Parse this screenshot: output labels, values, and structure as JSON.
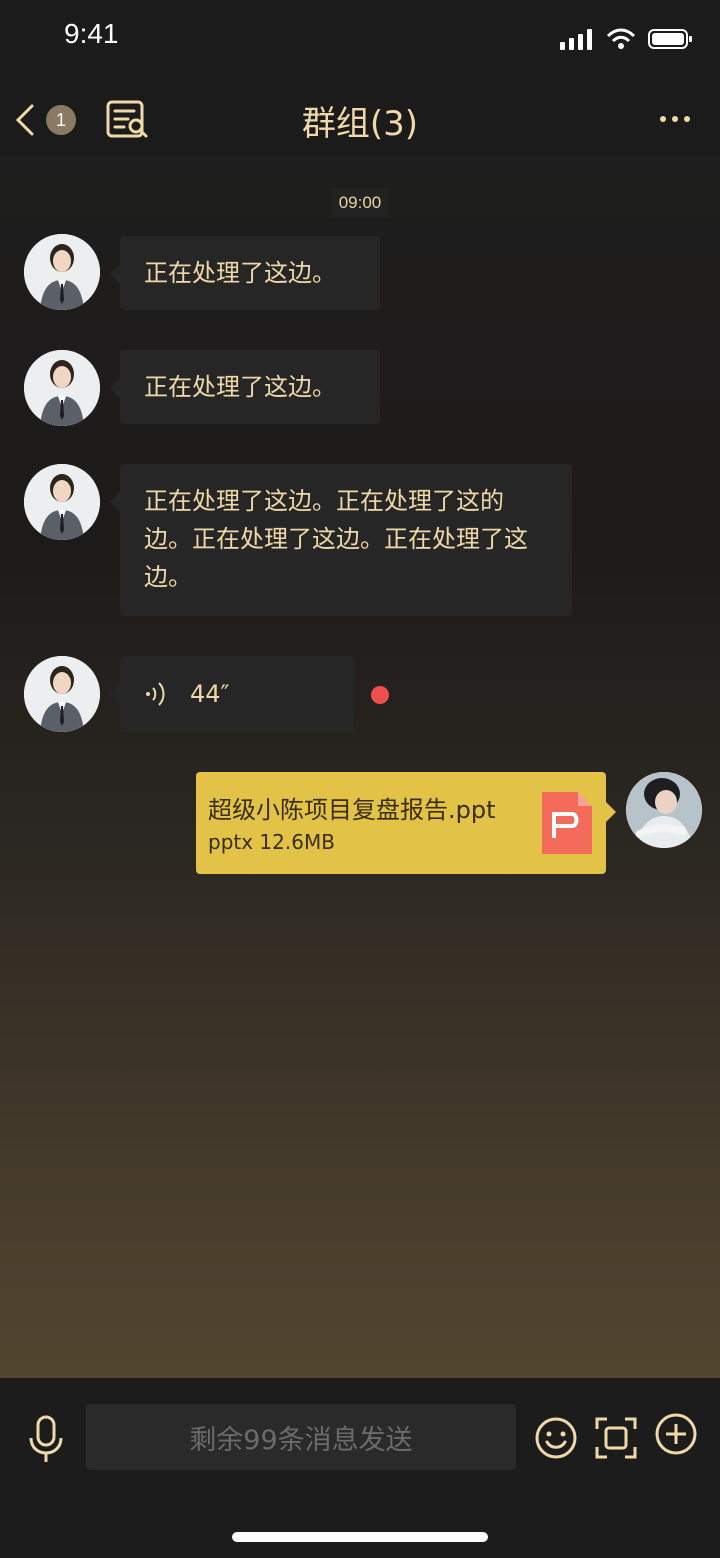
{
  "status": {
    "time": "9:41"
  },
  "nav": {
    "unread_count": "1",
    "title": "群组(3)"
  },
  "chat": {
    "timestamp": "09:00",
    "messages": [
      {
        "text": "正在处理了这边。"
      },
      {
        "text": "正在处理了这边。"
      },
      {
        "text": "正在处理了这边。正在处理了这的边。正在处理了这边。正在处理了这边。"
      }
    ],
    "voice": {
      "duration": "44″"
    },
    "file": {
      "name": "超级小陈项目复盘报告.ppt",
      "meta": "pptx 12.6MB"
    }
  },
  "input": {
    "placeholder": "剩余99条消息发送"
  },
  "icons": {
    "back": "chevron-left-icon",
    "notes": "notes-icon",
    "more": "more-icon",
    "mic": "microphone-icon",
    "emoji": "emoji-icon",
    "scan": "scan-icon",
    "plus": "plus-icon",
    "file": "ppt-file-icon"
  },
  "colors": {
    "accent_text": "#f0d9a8",
    "file_bubble": "#e2c247",
    "unread_dot": "#ef4e4e"
  }
}
